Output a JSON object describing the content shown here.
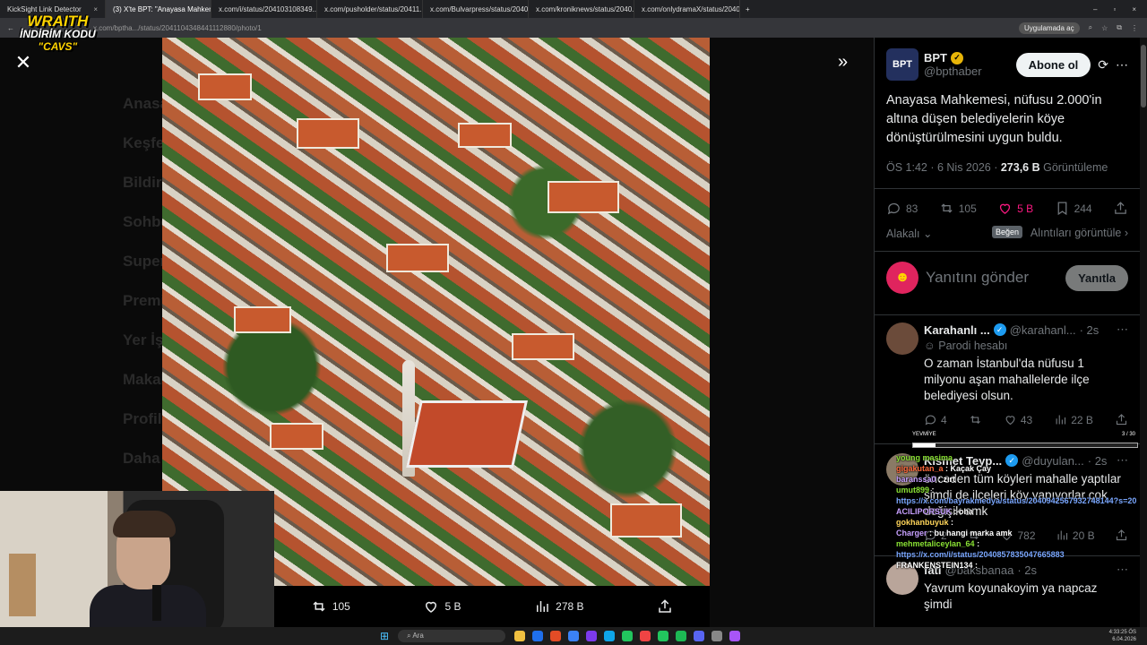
{
  "browser": {
    "tabs": [
      {
        "label": "KickSight Link Detector",
        "active": false
      },
      {
        "label": "(3) X'te BPT: \"Anayasa Mahkem...",
        "active": true
      },
      {
        "label": "x.com/i/status/204103108349...",
        "active": false
      },
      {
        "label": "x.com/pusholder/status/20411...",
        "active": false
      },
      {
        "label": "x.com/Bulvarpress/status/2040...",
        "active": false
      },
      {
        "label": "x.com/kroniknews/status/2040...",
        "active": false
      },
      {
        "label": "x.com/onlydramaX/status/2040...",
        "active": false
      }
    ],
    "url": "x.com/bptha.../status/2041104348441112880/photo/1",
    "ext_label": "Uygulamada aç"
  },
  "overlay": {
    "logo_title": "WRAITH",
    "logo_subtitle": "İNDİRİM KODU",
    "logo_code": "\"CAVS\""
  },
  "background_nav": [
    "Anasayfa",
    "Keşfet",
    "Bildirimler",
    "Sohbet",
    "Super",
    "Premium",
    "Yer İşaretleri",
    "Makaleler",
    "Profil",
    "Daha fazla"
  ],
  "photo_bar": {
    "retweets": "105",
    "likes": "5 B",
    "views": "278 B"
  },
  "post": {
    "avatar_text": "BPT",
    "display_name": "BPT",
    "handle": "@bpthaber",
    "follow_label": "Abone ol",
    "text": "Anayasa Mahkemesi, nüfusu 2.000'in altına düşen belediyelerin köye dönüştürülmesini uygun buldu.",
    "time": "ÖS 1:42 · 6 Nis 2026 · ",
    "views": "273,6 B",
    "views_label": " Görüntüleme",
    "replies": "83",
    "retweets": "105",
    "likes": "5 B",
    "bookmarks": "244",
    "related_label": "Alakalı",
    "quotes_label": "Alıntıları görüntüle",
    "tooltip": "Beğen"
  },
  "reply_box": {
    "placeholder": "Yanıtını gönder",
    "button": "Yanıtla"
  },
  "comments": [
    {
      "name": "Karahanlı ...",
      "handle": "@karahanl...",
      "time": "· 2s",
      "tag": "Parodi hesabı",
      "text": "O zaman İstanbul'da nüfusu 1 milyonu aşan mahallelerde ilçe belediyesi olsun.",
      "replies": "4",
      "retweets": "",
      "likes": "43",
      "views": "22 B"
    },
    {
      "name": "Kısmet Teyp...",
      "handle": "@duyulan...",
      "time": "· 2s",
      "tag": "",
      "text": "önceden tüm köyleri mahalle yaptılar şimdi de ilçeleri köy yapıyorlar çok değişik amk",
      "replies": "2",
      "retweets": "",
      "likes": "782",
      "views": "20 B"
    },
    {
      "name": "fati",
      "handle": "@baksbanaa",
      "time": "· 2s",
      "tag": "",
      "text": "Yavrum koyunakoyim ya napcaz şimdi",
      "replies": "",
      "retweets": "",
      "likes": "",
      "views": ""
    }
  ],
  "stream_chat": [
    {
      "user": "young masima",
      "msg": ""
    },
    {
      "user": "gigakutan_a",
      "msg": "Kaçak Çay"
    },
    {
      "user": "baranssa0",
      "msg": "zırt"
    },
    {
      "user": "umut899",
      "msg": ""
    },
    {
      "user": "",
      "msg": "https://x.com/bayrakmedya/status/2040942567932748144?s=20"
    },
    {
      "user": "ACILIPORSUK",
      "msg": "oha"
    },
    {
      "user": "gokhanbuyuk",
      "msg": ""
    },
    {
      "user": "Charger",
      "msg": "bu hangi marka amk"
    },
    {
      "user": "mehmetaliceylan_64",
      "msg": ""
    },
    {
      "user": "",
      "msg": "https://x.com/i/status/2040857835047665883"
    },
    {
      "user": "FRANKENSTEIN134",
      "msg": ""
    }
  ],
  "stream_progress": {
    "label": "YEVMİYE",
    "count": "3 / 30",
    "fraction": 0.1
  },
  "taskbar": {
    "search": "Ara",
    "time": "4:33:25 ÖS",
    "date": "6.04.2026"
  }
}
